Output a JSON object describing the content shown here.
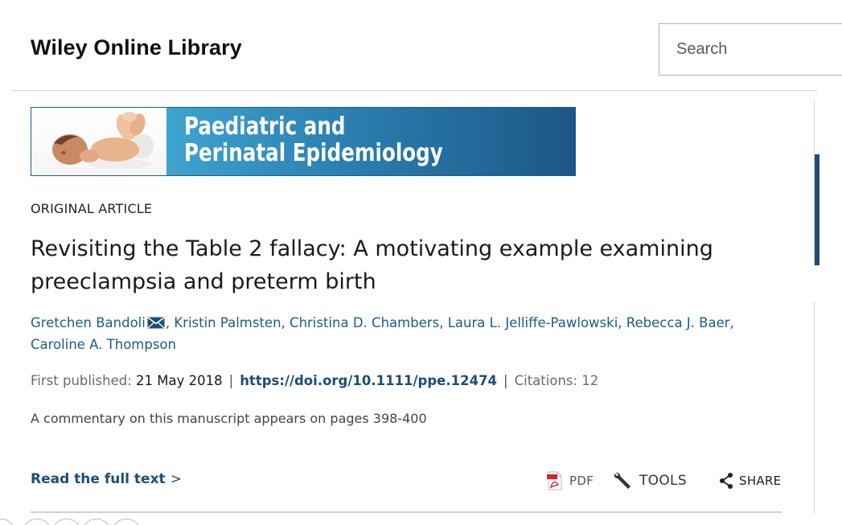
{
  "header": {
    "logo": "Wiley Online Library",
    "search_placeholder": "Search"
  },
  "journal": {
    "title_line1": "Paediatric and",
    "title_line2": "Perinatal Epidemiology"
  },
  "article": {
    "type": "ORIGINAL ARTICLE",
    "title": "Revisiting the Table 2 fallacy: A motivating example examining preeclampsia and preterm birth",
    "authors": [
      "Gretchen Bandoli",
      "Kristin Palmsten",
      "Christina D. Chambers",
      "Laura L. Jelliffe-Pawlowski",
      "Rebecca J. Baer",
      "Caroline A. Thompson"
    ],
    "first_published_label": "First published:",
    "first_published_date": "21 May 2018",
    "doi": "https://doi.org/10.1111/ppe.12474",
    "citations": "Citations: 12",
    "commentary": "A commentary on this manuscript appears on pages 398-400"
  },
  "actions": {
    "read_full": "Read the full text",
    "read_full_chevron": ">",
    "pdf": "PDF",
    "tools": "TOOLS",
    "share": "SHARE"
  },
  "colors": {
    "link": "#1d5c86",
    "doi": "#1d4d77",
    "banner_gradient_start": "#3fa4cf",
    "banner_gradient_end": "#1d5686",
    "pdf_red": "#d0262c"
  },
  "icons": {
    "author_contact": "envelope-icon",
    "pdf": "pdf-icon",
    "tools": "wrench-icon",
    "share": "share-icon"
  }
}
